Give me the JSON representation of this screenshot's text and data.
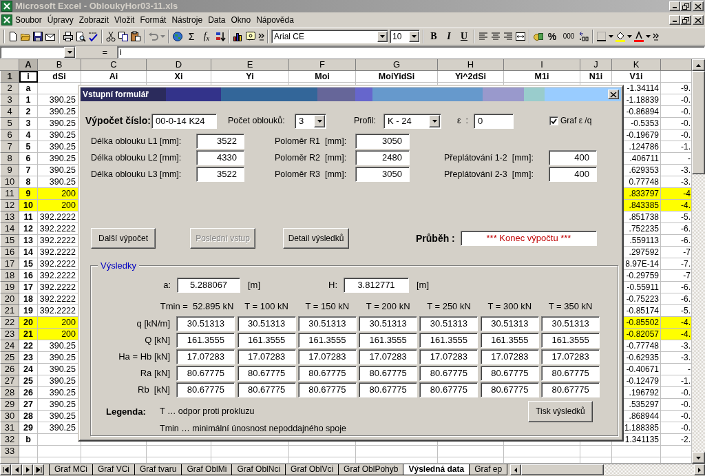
{
  "window": {
    "title": "Microsoft Excel - ObloukyHor03-11.xls"
  },
  "menu": [
    "Soubor",
    "Úpravy",
    "Zobrazit",
    "Vložit",
    "Formát",
    "Nástroje",
    "Data",
    "Okno",
    "Nápověda"
  ],
  "toolbar": {
    "sum": "Σ",
    "function": "f$_{x}$",
    "font": "Arial CE",
    "size": "10",
    "bold": "B",
    "italic": "I",
    "underline": "U",
    "percent": "%",
    "thousands": "000"
  },
  "formula_bar": {
    "equals": "=",
    "content": "i"
  },
  "columns": [
    {
      "letter": "A",
      "selected": true
    },
    {
      "letter": "B",
      "selected": false
    },
    {
      "letter": "C",
      "selected": false
    },
    {
      "letter": "D",
      "selected": false
    },
    {
      "letter": "E",
      "selected": false
    },
    {
      "letter": "F",
      "selected": false
    },
    {
      "letter": "G",
      "selected": false
    },
    {
      "letter": "H",
      "selected": false
    },
    {
      "letter": "I",
      "selected": false
    },
    {
      "letter": "J",
      "selected": false
    },
    {
      "letter": "K",
      "selected": false
    }
  ],
  "header_row": {
    "number": "1",
    "selected": true,
    "cells": [
      "i",
      "dSi",
      "Ai",
      "Xi",
      "Yi",
      "Moi",
      "MoiYidSi",
      "Yi^2dSi",
      "M1i",
      "N1i",
      "V1i"
    ]
  },
  "rows": [
    {
      "number": "2",
      "highlighted": false,
      "A": "a",
      "K": "-1.34114",
      "L": "-9."
    },
    {
      "number": "3",
      "highlighted": false,
      "A": "1",
      "B": "390.25",
      "K": "-1.18839",
      "L": "-0."
    },
    {
      "number": "4",
      "highlighted": false,
      "A": "2",
      "B": "390.25",
      "K": "-0.86894",
      "L": "-0."
    },
    {
      "number": "5",
      "highlighted": false,
      "A": "3",
      "B": "390.25",
      "K": "-0.5353",
      "L": "-0."
    },
    {
      "number": "6",
      "highlighted": false,
      "A": "4",
      "B": "390.25",
      "K": "-0.19679",
      "L": "-0."
    },
    {
      "number": "7",
      "highlighted": false,
      "A": "5",
      "B": "390.25",
      "K": ".124786",
      "L": "-1."
    },
    {
      "number": "8",
      "highlighted": false,
      "A": "6",
      "B": "390.25",
      "K": ".406711",
      "L": "-"
    },
    {
      "number": "9",
      "highlighted": false,
      "A": "7",
      "B": "390.25",
      "K": ".629353",
      "L": "-3."
    },
    {
      "number": "10",
      "highlighted": false,
      "A": "8",
      "B": "390.25",
      "K": "0.77748",
      "L": "-3."
    },
    {
      "number": "11",
      "highlighted": true,
      "A": "9",
      "B": "200",
      "K": ".833797",
      "L": "-4"
    },
    {
      "number": "12",
      "highlighted": true,
      "A": "10",
      "B": "200",
      "K": ".843385",
      "L": "-4."
    },
    {
      "number": "13",
      "highlighted": false,
      "A": "11",
      "B": "392.2222",
      "K": ".851738",
      "L": "-5."
    },
    {
      "number": "14",
      "highlighted": false,
      "A": "12",
      "B": "392.2222",
      "K": ".752235",
      "L": "-6."
    },
    {
      "number": "15",
      "highlighted": false,
      "A": "13",
      "B": "392.2222",
      "K": ".559113",
      "L": "-6."
    },
    {
      "number": "16",
      "highlighted": false,
      "A": "14",
      "B": "392.2222",
      "K": ".297592",
      "L": "-7"
    },
    {
      "number": "17",
      "highlighted": false,
      "A": "15",
      "B": "392.2222",
      "K": "8.97E-14",
      "L": "-7."
    },
    {
      "number": "18",
      "highlighted": false,
      "A": "16",
      "B": "392.2222",
      "K": "-0.29759",
      "L": "-7"
    },
    {
      "number": "19",
      "highlighted": false,
      "A": "17",
      "B": "392.2222",
      "K": "-0.55911",
      "L": "-6."
    },
    {
      "number": "20",
      "highlighted": false,
      "A": "18",
      "B": "392.2222",
      "K": "-0.75223",
      "L": "-6."
    },
    {
      "number": "21",
      "highlighted": false,
      "A": "19",
      "B": "392.2222",
      "K": "-0.85174",
      "L": "-5."
    },
    {
      "number": "22",
      "highlighted": true,
      "A": "20",
      "B": "200",
      "K": "-0.85502",
      "L": "-4."
    },
    {
      "number": "23",
      "highlighted": true,
      "A": "21",
      "B": "200",
      "K": "-0.82057",
      "L": "-4."
    },
    {
      "number": "24",
      "highlighted": false,
      "A": "22",
      "B": "390.25",
      "K": "-0.77748",
      "L": "-3."
    },
    {
      "number": "25",
      "highlighted": false,
      "A": "23",
      "B": "390.25",
      "K": "-0.62935",
      "L": "-3."
    },
    {
      "number": "26",
      "highlighted": false,
      "A": "24",
      "B": "390.25",
      "K": "-0.40671",
      "L": "-"
    },
    {
      "number": "27",
      "highlighted": false,
      "A": "25",
      "B": "390.25",
      "K": "-0.12479",
      "L": "-1."
    },
    {
      "number": "28",
      "highlighted": false,
      "A": "26",
      "B": "390.25",
      "K": ".196792",
      "L": "-0."
    },
    {
      "number": "29",
      "highlighted": false,
      "A": "27",
      "B": "390.25",
      "K": ".535297",
      "L": "-0."
    },
    {
      "number": "30",
      "highlighted": false,
      "A": "28",
      "B": "390.25",
      "K": ".868944",
      "L": "-0."
    },
    {
      "number": "31",
      "highlighted": false,
      "A": "29",
      "B": "390.25",
      "K": "1.188385",
      "L": "-0."
    },
    {
      "number": "32",
      "highlighted": false,
      "A": "b",
      "K": "1.341135",
      "L": "-2."
    },
    {
      "number": "33",
      "highlighted": false
    }
  ],
  "sheet_tabs": [
    {
      "label": "Graf MCi",
      "selected": false
    },
    {
      "label": "Graf VCi",
      "selected": false
    },
    {
      "label": "Graf tvaru",
      "selected": false
    },
    {
      "label": "Graf OblMi",
      "selected": false
    },
    {
      "label": "Graf OblNci",
      "selected": false
    },
    {
      "label": "Graf OblVci",
      "selected": false
    },
    {
      "label": "Graf OblPohyb",
      "selected": false
    },
    {
      "label": "Výsledná data",
      "selected": true
    },
    {
      "label": "Graf ep",
      "selected": false
    }
  ],
  "dialog": {
    "title": "Vstupní formulář",
    "calc_number": {
      "label": "Výpočet číslo:",
      "value": "00-0-14 K24"
    },
    "arc_count": {
      "label": "Počet oblouků:",
      "value": "3"
    },
    "profile": {
      "label": "Profil:",
      "value": "K - 24"
    },
    "epsilon": {
      "label": "ε  :",
      "value": "0"
    },
    "graph_option": {
      "label": "Graf ε /q",
      "checked": true
    },
    "lengths": [
      {
        "label": "Délka oblouku L1 [mm]:",
        "value": "3522"
      },
      {
        "label": "Délka oblouku L2 [mm]:",
        "value": "4330"
      },
      {
        "label": "Délka oblouku L3 [mm]:",
        "value": "3522"
      }
    ],
    "radii": [
      {
        "label": "Poloměr R1  [mm]:",
        "value": "3050"
      },
      {
        "label": "Poloměr R2  [mm]:",
        "value": "2480"
      },
      {
        "label": "Poloměr R3  [mm]:",
        "value": "3050"
      }
    ],
    "overlaps": [
      {
        "label": "Přeplátování 1-2  [mm]:",
        "value": "400"
      },
      {
        "label": "Přeplátování 2-3  [mm]:",
        "value": "400"
      }
    ],
    "buttons": [
      {
        "label": "Další výpočet",
        "disabled": false
      },
      {
        "label": "Poslední vstup",
        "disabled": true
      },
      {
        "label": "Detail výsledků",
        "disabled": false
      }
    ],
    "progress": {
      "label": "Průběh :",
      "value": "*** Konec výpočtu ***"
    },
    "results": {
      "title": "Výsledky",
      "a": {
        "label": "a:",
        "value": "5.288067",
        "unit": "[m]"
      },
      "h": {
        "label": "H:",
        "value": "3.812771",
        "unit": "[m]"
      },
      "columns": [
        "Tmin =  52.895 kN",
        "T = 100 kN",
        "T = 150 kN",
        "T = 200 kN",
        "T = 250 kN",
        "T = 300 kN",
        "T = 350 kN"
      ],
      "rows": [
        {
          "label": "q [kN/m]",
          "values": [
            "30.51313",
            "30.51313",
            "30.51313",
            "30.51313",
            "30.51313",
            "30.51313",
            "30.51313"
          ]
        },
        {
          "label": "Q [kN]",
          "values": [
            "161.3555",
            "161.3555",
            "161.3555",
            "161.3555",
            "161.3555",
            "161.3555",
            "161.3555"
          ]
        },
        {
          "label": "Ha = Hb [kN]",
          "values": [
            "17.07283",
            "17.07283",
            "17.07283",
            "17.07283",
            "17.07283",
            "17.07283",
            "17.07283"
          ]
        },
        {
          "label": "Ra [kN]",
          "values": [
            "80.67775",
            "80.67775",
            "80.67775",
            "80.67775",
            "80.67775",
            "80.67775",
            "80.67775"
          ]
        },
        {
          "label": "Rb  [kN]",
          "values": [
            "80.67775",
            "80.67775",
            "80.67775",
            "80.67775",
            "80.67775",
            "80.67775",
            "80.67775"
          ]
        }
      ],
      "legend": {
        "label": "Legenda:",
        "lines": [
          "T … odpor proti prokluzu",
          "Tmin … minimální únosnost nepoddajného spoje"
        ]
      },
      "print_button": "Tisk výsledků"
    }
  }
}
